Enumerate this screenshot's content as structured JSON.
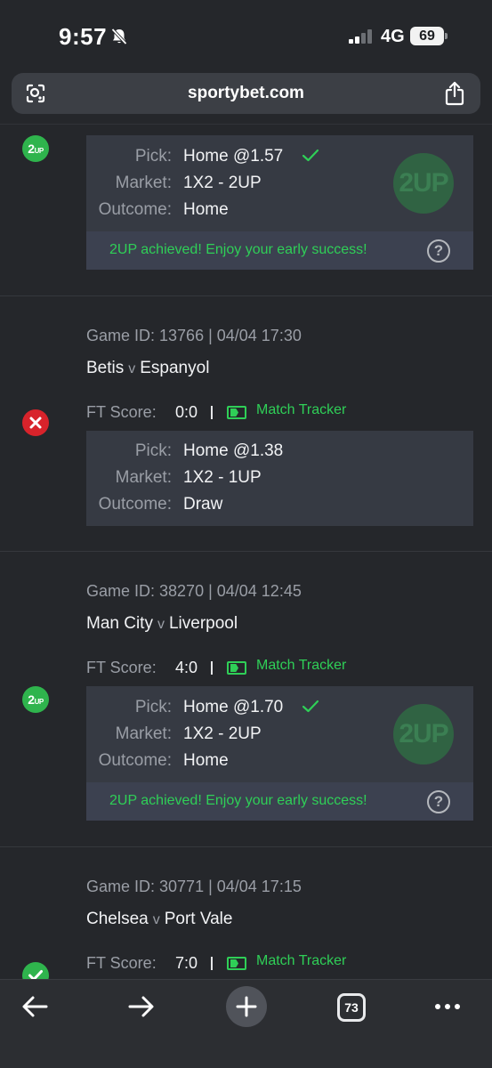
{
  "status_bar": {
    "time": "9:57",
    "network": "4G",
    "battery": "69"
  },
  "browser": {
    "url": "sportybet.com",
    "tabs_count": "73"
  },
  "colors": {
    "background": "#25272b",
    "card": "#363a43",
    "win_green": "#2fcf57",
    "loss_red": "#d8232b"
  },
  "labels": {
    "game_id": "Game ID:",
    "ft_score": "FT Score:",
    "match_tracker": "Match Tracker",
    "pick": "Pick:",
    "market": "Market:",
    "outcome": "Outcome:",
    "vs": "v",
    "achieved": "2UP achieved! Enjoy your early success!",
    "badge_2up": "2",
    "badge_2up_small": "UP",
    "watermark": "2UP",
    "help": "?"
  },
  "games": [
    {
      "status": "2UP",
      "pick": "Home @1.57",
      "market": "1X2 - 2UP",
      "outcome": "Home"
    },
    {
      "status": "lost",
      "game_id_text": "Game ID: 13766 | 04/04 17:30",
      "home": "Betis",
      "away": "Espanyol",
      "ft_score": "0:0",
      "pick": "Home @1.38",
      "market": "1X2 - 1UP",
      "outcome": "Draw"
    },
    {
      "status": "2UP",
      "game_id_text": "Game ID: 38270 | 04/04 12:45",
      "home": "Man City",
      "away": "Liverpool",
      "ft_score": "4:0",
      "pick": "Home @1.70",
      "market": "1X2 - 2UP",
      "outcome": "Home"
    },
    {
      "status": "won",
      "game_id_text": "Game ID: 30771 | 04/04 17:15",
      "home": "Chelsea",
      "away": "Port Vale",
      "ft_score": "7:0"
    }
  ]
}
